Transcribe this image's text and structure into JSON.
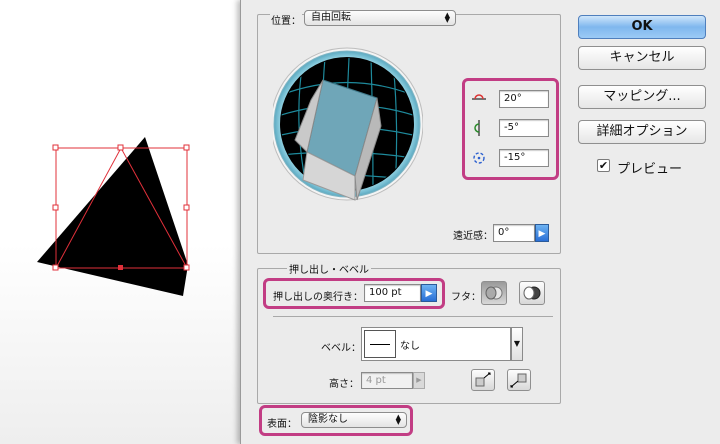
{
  "position": {
    "label": "位置：",
    "value": "自由回転",
    "x_rotation": "20°",
    "y_rotation": "-5°",
    "z_rotation": "-15°",
    "perspective_label": "遠近感：",
    "perspective_value": "0°"
  },
  "extrude": {
    "title": "押し出し・ベベル",
    "depth_label": "押し出しの奥行き：",
    "depth_value": "100 pt",
    "cap_label": "フタ：",
    "bevel_label": "ベベル：",
    "bevel_value": "なし",
    "height_label": "高さ：",
    "height_value": "4 pt"
  },
  "surface": {
    "label": "表面：",
    "value": "陰影なし"
  },
  "buttons": {
    "ok": "OK",
    "cancel": "キャンセル",
    "mapping": "マッピング...",
    "more_options": "詳細オプション",
    "preview": "プレビュー"
  },
  "colors": {
    "highlight": "#c23d84",
    "accent_blue": "#2a6fd6",
    "cube_face": "#6fa6b8"
  }
}
